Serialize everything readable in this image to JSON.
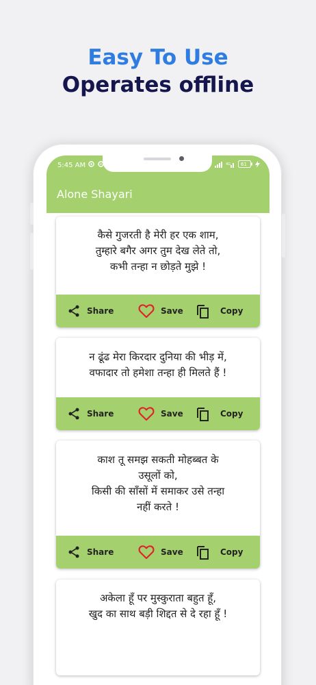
{
  "promo": {
    "line1": "Easy To Use",
    "line2": "Operates offline",
    "line1_color": "#2f7de0",
    "line2_color": "#16164f"
  },
  "status_bar": {
    "time": "5:45 AM",
    "left_icons": [
      "app-notification-icon",
      "settings-notification-icon"
    ],
    "right_icons": [
      "signal-icon",
      "4g-signal-icon",
      "battery-icon",
      "charging-icon"
    ],
    "battery_level": "61"
  },
  "app": {
    "title": "Alone Shayari",
    "accent_color": "#a4d16e"
  },
  "cards": [
    {
      "lines": [
        "कैसे गुजरती है मेरी हर एक शाम,",
        "तुम्हारे बगैर अगर तुम देख लेते तो,",
        "कभी तन्हा न छोड़ते मुझे !"
      ],
      "share": "Share",
      "save": "Save",
      "copy": "Copy"
    },
    {
      "lines": [
        "न ढूंढ मेरा किरदार दुनिया की भीड़ में,",
        "वफादार तो हमेशा तन्हा ही मिलते हैं !"
      ],
      "share": "Share",
      "save": "Save",
      "copy": "Copy"
    },
    {
      "lines": [
        "काश तू समझ सकती मोहब्बत के",
        "उसूलों को,",
        "किसी की साँसों में समाकर उसे तन्हा",
        "नहीं करते !"
      ],
      "share": "Share",
      "save": "Save",
      "copy": "Copy"
    },
    {
      "lines": [
        "अकेला हूँ पर मुस्कुराता बहुत हूँ,",
        "खुद का साथ बड़ी शिद्दत से दे रहा हूँ !"
      ],
      "share": "",
      "save": "",
      "copy": ""
    }
  ],
  "icon_colors": {
    "heart": "#e0232a",
    "dark": "#222222"
  }
}
